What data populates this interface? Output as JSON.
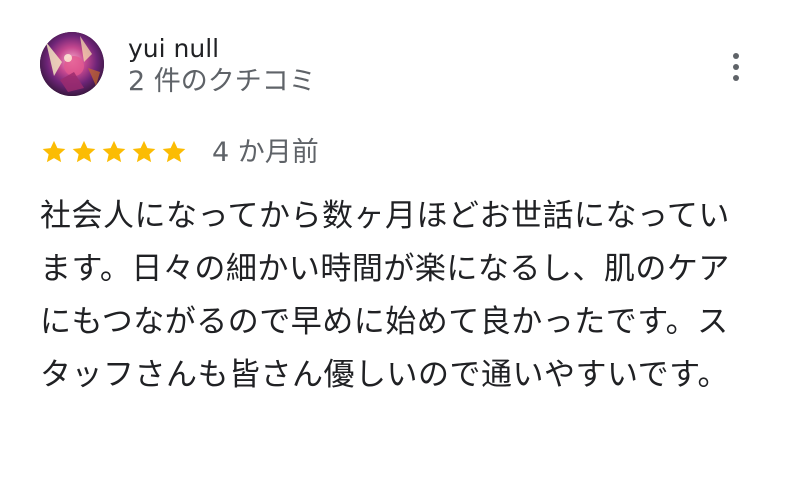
{
  "review": {
    "author_name": "yui null",
    "review_count": "2 件のクチコミ",
    "more_options_icon": "vertical-ellipsis-icon",
    "rating": 5,
    "rating_max": 5,
    "star_color": "#fbbc04",
    "date": "4 か月前",
    "text": "社会人になってから数ヶ月ほどお世話になっています。日々の細かい時間が楽になるし、肌のケアにもつながるので早めに始めて良かったです。スタッフさんも皆さん優しいので通いやすいです。"
  }
}
